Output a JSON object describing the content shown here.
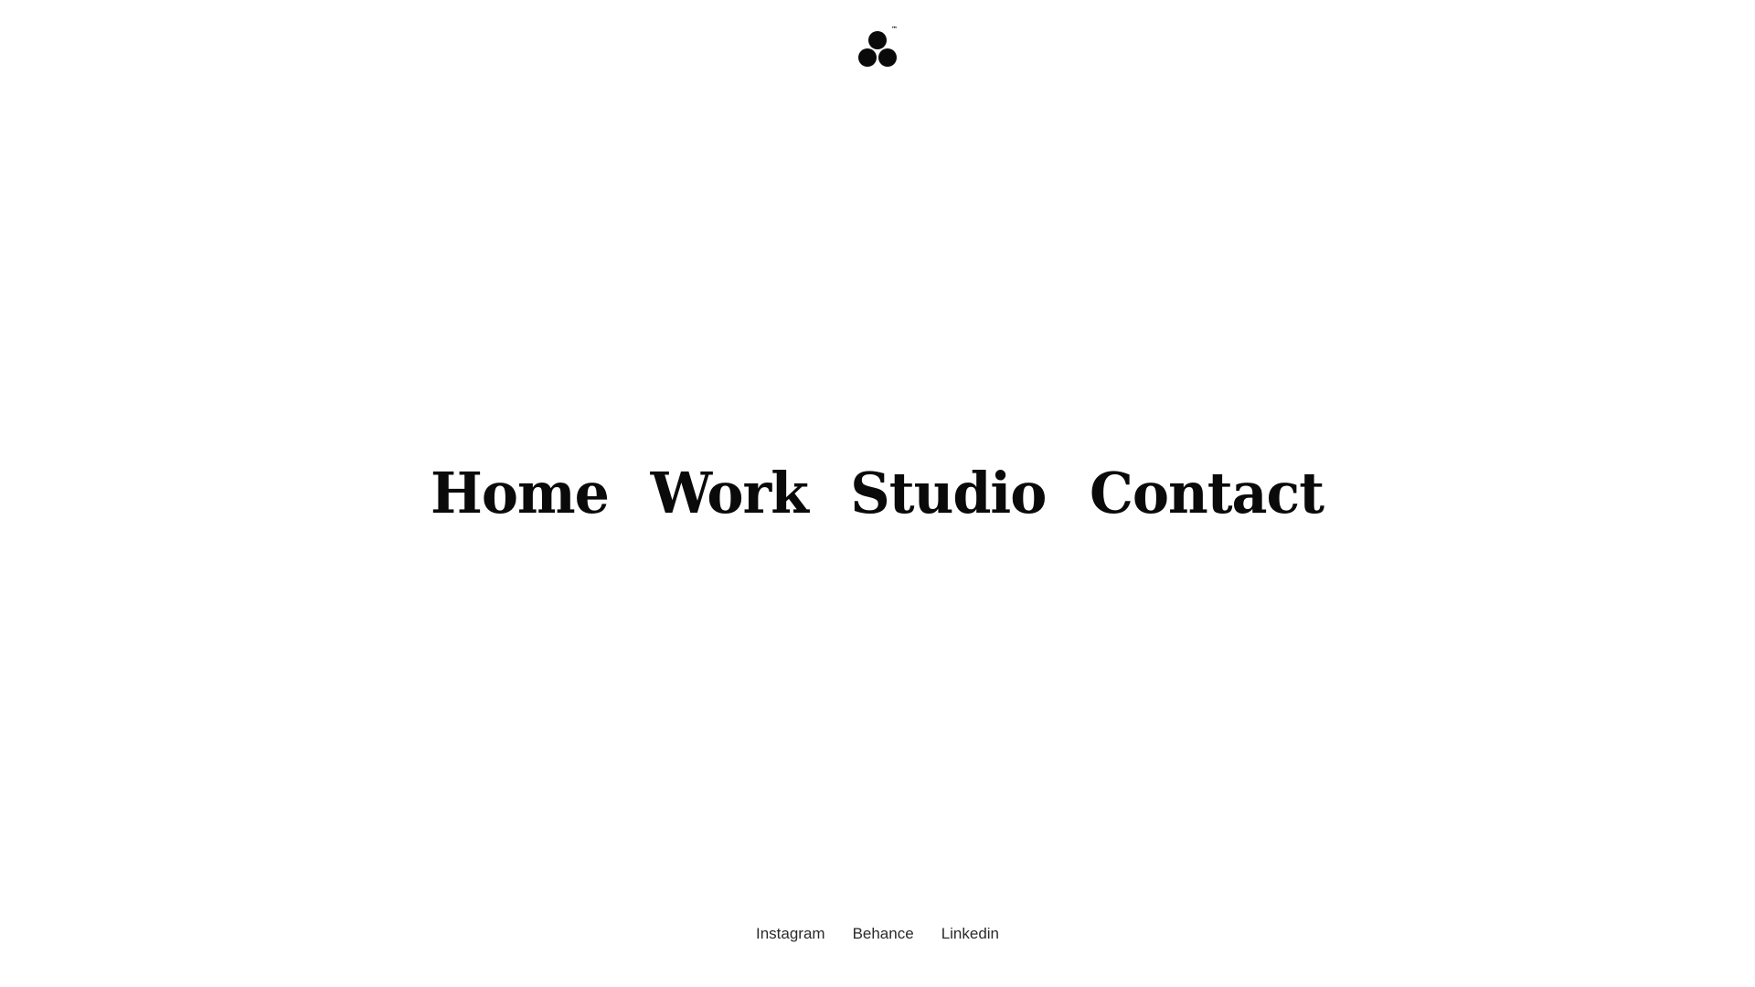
{
  "brand": {
    "logo_icon": "three-circles-logo-icon",
    "trademark": "™"
  },
  "nav": {
    "items": [
      {
        "label": "Home"
      },
      {
        "label": "Work"
      },
      {
        "label": "Studio"
      },
      {
        "label": "Contact"
      }
    ]
  },
  "social": {
    "items": [
      {
        "label": "Instagram"
      },
      {
        "label": "Behance"
      },
      {
        "label": "Linkedin"
      }
    ]
  },
  "colors": {
    "background": "#ffffff",
    "text": "#0a0a0a"
  }
}
